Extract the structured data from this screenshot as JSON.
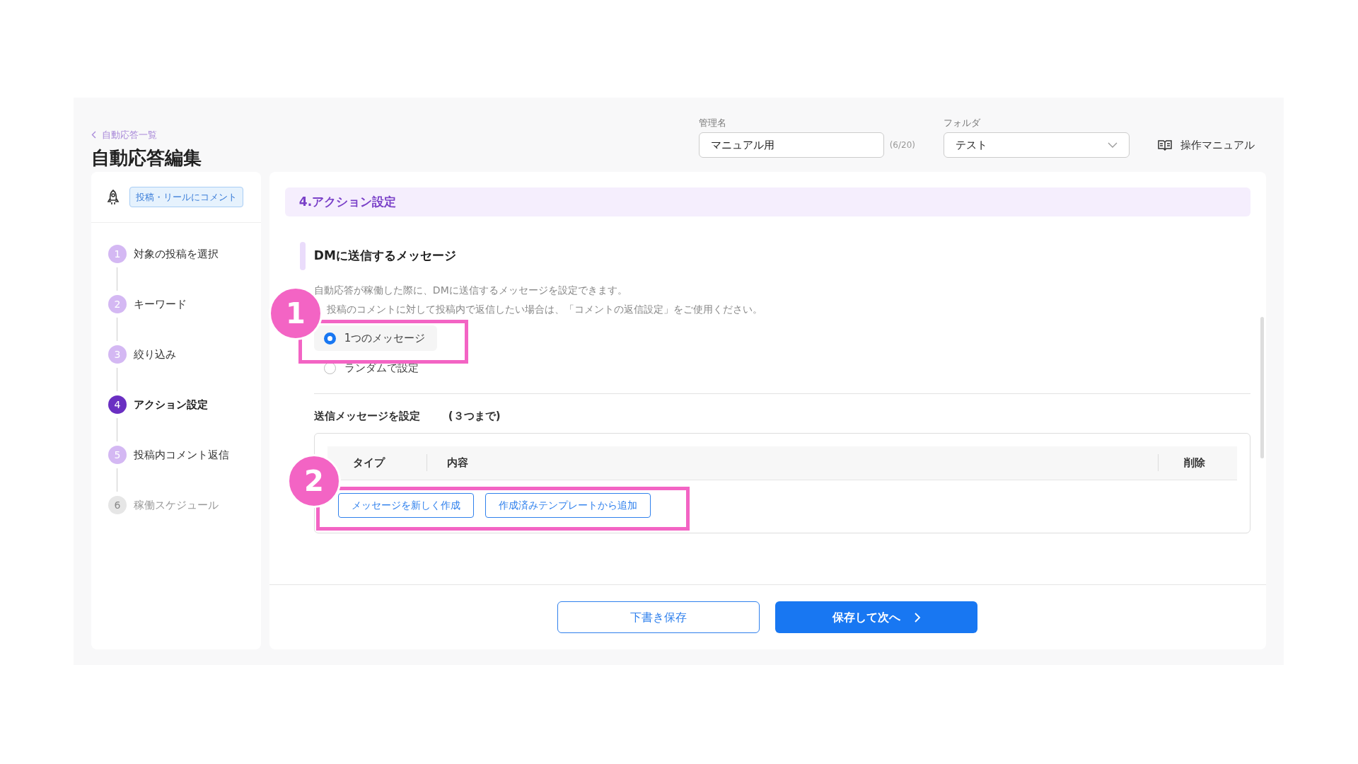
{
  "header": {
    "back_link": "自動応答一覧",
    "title": "自動応答編集",
    "name_field": {
      "label": "管理名",
      "value": "マニュアル用",
      "counter": "(6/20)"
    },
    "folder_field": {
      "label": "フォルダ",
      "value": "テスト"
    },
    "manual_link": "操作マニュアル"
  },
  "sidebar": {
    "trigger_tag": "投稿・リールにコメント",
    "steps": [
      {
        "number": "1",
        "label": "対象の投稿を選択",
        "current": false,
        "disabled": false
      },
      {
        "number": "2",
        "label": "キーワード",
        "current": false,
        "disabled": false
      },
      {
        "number": "3",
        "label": "絞り込み",
        "current": false,
        "disabled": false
      },
      {
        "number": "4",
        "label": "アクション設定",
        "current": true,
        "disabled": false
      },
      {
        "number": "5",
        "label": "投稿内コメント返信",
        "current": false,
        "disabled": false
      },
      {
        "number": "6",
        "label": "稼働スケジュール",
        "current": false,
        "disabled": true
      }
    ]
  },
  "main": {
    "section_title": "4.アクション設定",
    "subsection_title": "DMに送信するメッセージ",
    "description": [
      "自動応答が稼働した際に、DMに送信するメッセージを設定できます。",
      "投稿のコメントに対して投稿内で返信したい場合は、「コメントの返信設定」をご使用ください。"
    ],
    "radio_options": [
      {
        "label": "1つのメッセージ",
        "selected": true
      },
      {
        "label": "ランダムで設定",
        "selected": false
      }
    ],
    "messages_label": "送信メッセージを設定",
    "messages_limit": "(３つまで)",
    "table": {
      "columns": [
        "タイプ",
        "内容",
        "削除"
      ]
    },
    "add_buttons": [
      "メッセージを新しく作成",
      "作成済みテンプレートから追加"
    ]
  },
  "footer": {
    "draft_button": "下書き保存",
    "next_button": "保存して次へ"
  },
  "annotations": [
    "1",
    "2"
  ]
}
